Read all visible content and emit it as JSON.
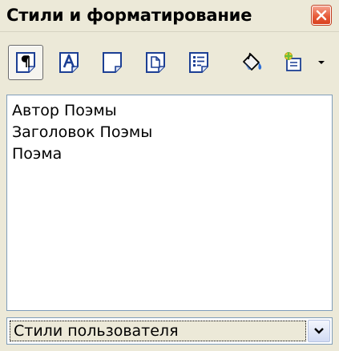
{
  "window": {
    "title": "Стили и форматирование",
    "close_icon": "close-icon"
  },
  "toolbar": {
    "buttons": [
      {
        "icon": "paragraph-styles-icon",
        "active": true
      },
      {
        "icon": "character-styles-icon",
        "active": false
      },
      {
        "icon": "frame-styles-icon",
        "active": false
      },
      {
        "icon": "page-styles-icon",
        "active": false
      },
      {
        "icon": "list-styles-icon",
        "active": false
      },
      {
        "icon": "fill-format-mode-icon",
        "active": false
      },
      {
        "icon": "new-style-from-selection-icon",
        "active": false
      },
      {
        "icon": "chevron-down-icon",
        "active": false
      }
    ]
  },
  "styles_list": {
    "items": [
      "Автор Поэмы",
      "Заголовок Поэмы",
      "Поэма"
    ]
  },
  "filter": {
    "selected": "Стили пользователя"
  },
  "colors": {
    "panel_bg": "#ece9d8",
    "list_border": "#7f9db9",
    "close_red": "#e75c3b"
  }
}
